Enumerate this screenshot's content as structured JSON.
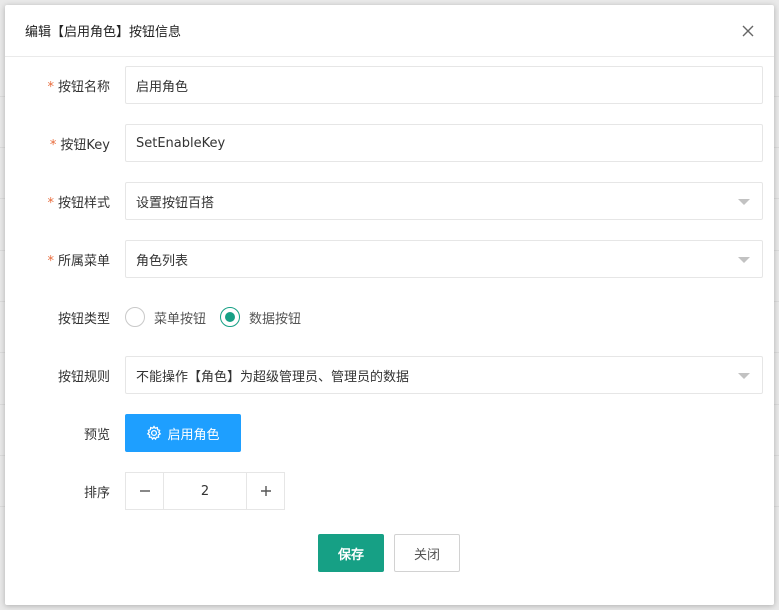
{
  "dialog": {
    "title": "编辑【启用角色】按钮信息"
  },
  "form": {
    "name": {
      "label": "按钮名称",
      "value": "启用角色"
    },
    "key": {
      "label": "按钮Key",
      "value": "SetEnableKey"
    },
    "style": {
      "label": "按钮样式",
      "value": "设置按钮百搭"
    },
    "menu": {
      "label": "所属菜单",
      "value": "角色列表"
    },
    "type": {
      "label": "按钮类型",
      "options": [
        "菜单按钮",
        "数据按钮"
      ],
      "selected": "数据按钮"
    },
    "rule": {
      "label": "按钮规则",
      "value": "不能操作【角色】为超级管理员、管理员的数据"
    },
    "preview": {
      "label": "预览",
      "button_label": "启用角色"
    },
    "order": {
      "label": "排序",
      "value": "2"
    }
  },
  "footer": {
    "save_label": "保存",
    "close_label": "关闭"
  },
  "colors": {
    "primary": "#16a085",
    "preview": "#1e9fff",
    "required": "#e86a3a"
  }
}
